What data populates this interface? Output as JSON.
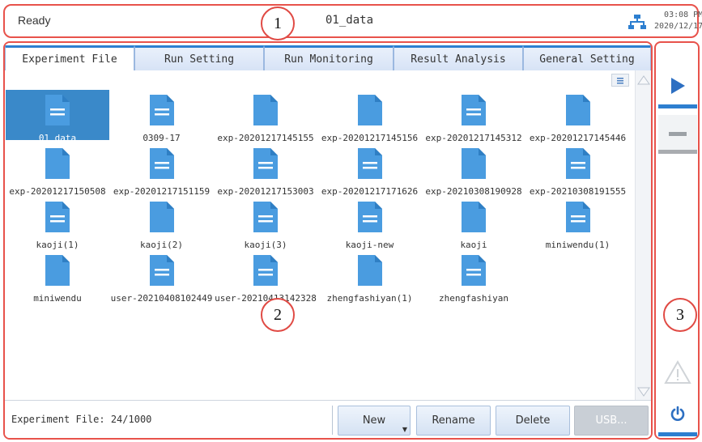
{
  "status": {
    "state": "Ready",
    "current_file": "01_data",
    "time": "03:08 PM",
    "date": "2020/12/17",
    "network_icon": "network-icon"
  },
  "markers": [
    "1",
    "2",
    "3"
  ],
  "tabs": [
    {
      "label": "Experiment File",
      "active": true
    },
    {
      "label": "Run Setting",
      "active": false
    },
    {
      "label": "Run Monitoring",
      "active": false
    },
    {
      "label": "Result Analysis",
      "active": false
    },
    {
      "label": "General Setting",
      "active": false
    }
  ],
  "files": [
    {
      "name": "01_data",
      "icon": "data-file-icon",
      "selected": true
    },
    {
      "name": "0309-17",
      "icon": "data-file-icon"
    },
    {
      "name": "exp-20201217145155",
      "icon": "blank-file-icon"
    },
    {
      "name": "exp-20201217145156",
      "icon": "blank-file-icon"
    },
    {
      "name": "exp-20201217145312",
      "icon": "data-file-icon"
    },
    {
      "name": "exp-20201217145446",
      "icon": "blank-file-icon"
    },
    {
      "name": "exp-20201217150508",
      "icon": "blank-file-icon"
    },
    {
      "name": "exp-20201217151159",
      "icon": "data-file-icon"
    },
    {
      "name": "exp-20201217153003",
      "icon": "data-file-icon"
    },
    {
      "name": "exp-20201217171626",
      "icon": "data-file-icon"
    },
    {
      "name": "exp-20210308190928",
      "icon": "blank-file-icon"
    },
    {
      "name": "exp-20210308191555",
      "icon": "data-file-icon"
    },
    {
      "name": "kaoji(1)",
      "icon": "data-file-icon"
    },
    {
      "name": "kaoji(2)",
      "icon": "blank-file-icon"
    },
    {
      "name": "kaoji(3)",
      "icon": "data-file-icon"
    },
    {
      "name": "kaoji-new",
      "icon": "data-file-icon"
    },
    {
      "name": "kaoji",
      "icon": "blank-file-icon"
    },
    {
      "name": "miniwendu(1)",
      "icon": "data-file-icon"
    },
    {
      "name": "miniwendu",
      "icon": "blank-file-icon"
    },
    {
      "name": "user-20210408102449",
      "icon": "data-file-icon"
    },
    {
      "name": "user-20210413142328",
      "icon": "data-file-icon"
    },
    {
      "name": "zhengfashiyan(1)",
      "icon": "blank-file-icon"
    },
    {
      "name": "zhengfashiyan",
      "icon": "data-file-icon"
    }
  ],
  "bottom": {
    "file_count": "Experiment File: 24/1000",
    "buttons": [
      {
        "label": "New",
        "has_caret": true,
        "disabled": false
      },
      {
        "label": "Rename",
        "disabled": false
      },
      {
        "label": "Delete",
        "disabled": false
      },
      {
        "label": "USB...",
        "disabled": true
      }
    ]
  },
  "side": {
    "run_icon": "play-icon",
    "stop_icon": "stop-icon",
    "warning_icon": "warning-icon",
    "power_icon": "power-icon"
  },
  "colors": {
    "accent": "#2d7fd0",
    "annotation": "#e8524b",
    "file_icon": "#4a9ce0",
    "selected": "#3a89c9"
  }
}
